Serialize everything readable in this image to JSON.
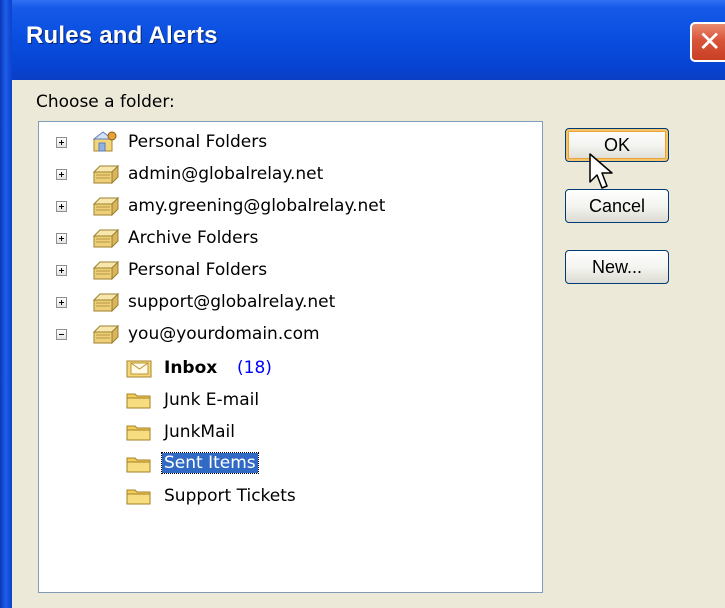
{
  "window": {
    "title": "Rules and Alerts",
    "close_glyph": "✕"
  },
  "prompt": "Choose a folder:",
  "tree": {
    "items": [
      {
        "label": "Personal Folders",
        "icon": "personal-folders-icon",
        "expander": "plus"
      },
      {
        "label": "admin@globalrelay.net",
        "icon": "mailbox-icon",
        "expander": "plus"
      },
      {
        "label": "amy.greening@globalrelay.net",
        "icon": "mailbox-icon",
        "expander": "plus"
      },
      {
        "label": "Archive Folders",
        "icon": "mailbox-icon",
        "expander": "plus"
      },
      {
        "label": "Personal Folders",
        "icon": "mailbox-icon",
        "expander": "plus"
      },
      {
        "label": "support@globalrelay.net",
        "icon": "mailbox-icon",
        "expander": "plus"
      },
      {
        "label": "you@yourdomain.com",
        "icon": "mailbox-icon",
        "expander": "minus"
      },
      {
        "label": "Inbox",
        "count": "(18)",
        "icon": "inbox-icon"
      },
      {
        "label": "Junk E-mail",
        "icon": "folder-icon"
      },
      {
        "label": "JunkMail",
        "icon": "folder-icon"
      },
      {
        "label": "Sent Items",
        "icon": "folder-icon",
        "selected": true
      },
      {
        "label": "Support Tickets",
        "icon": "folder-icon"
      }
    ]
  },
  "buttons": {
    "ok": "OK",
    "cancel": "Cancel",
    "new": "New..."
  },
  "colors": {
    "titlebar": "#0a4fe0",
    "dialog_bg": "#ece9d8",
    "selection": "#316ac5",
    "unread_count": "#0000ff"
  }
}
